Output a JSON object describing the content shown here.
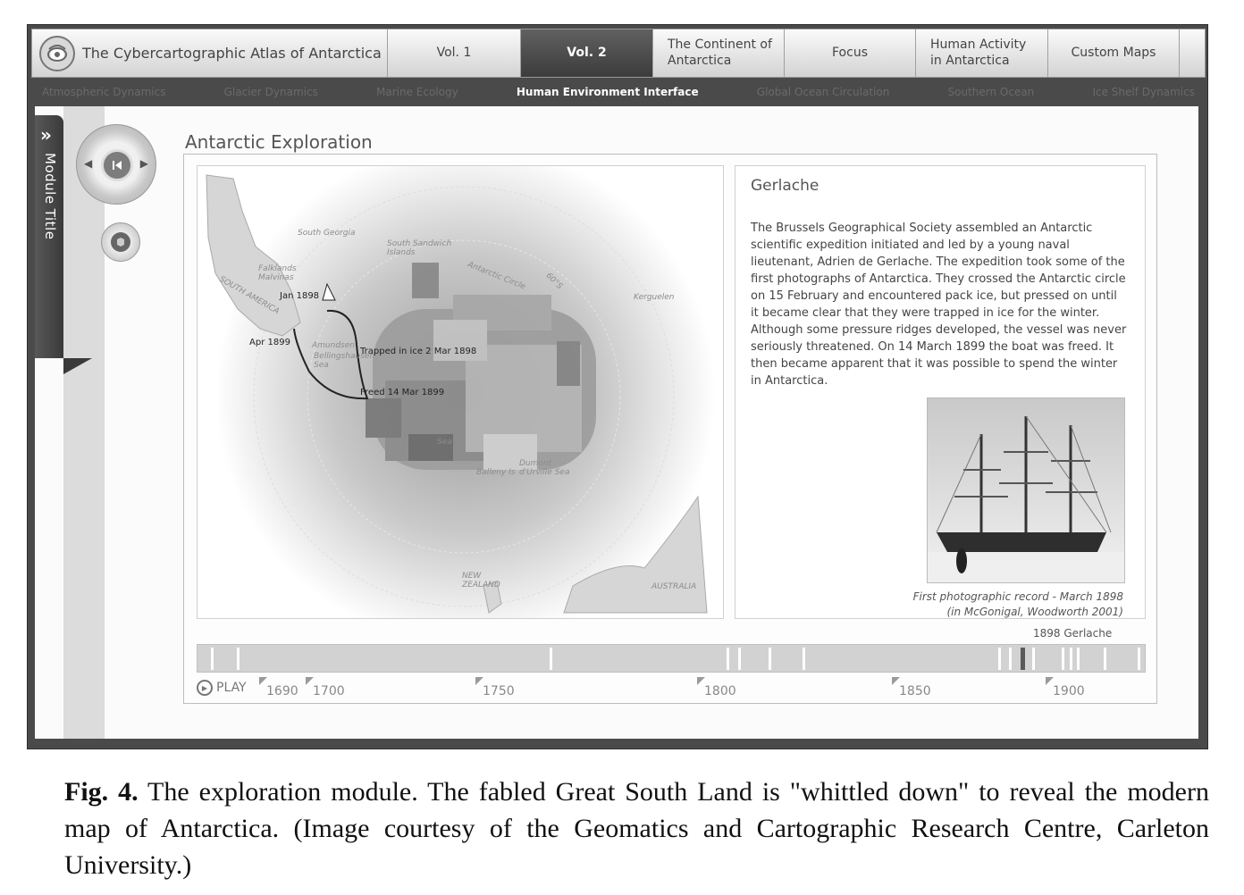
{
  "header": {
    "brand": "The Cybercartographic Atlas of Antarctica",
    "tabs": [
      {
        "label": "Vol. 1"
      },
      {
        "label": "Vol. 2",
        "active": true
      },
      {
        "line1": "The Continent of",
        "line2": "Antarctica"
      },
      {
        "label": "Focus"
      },
      {
        "line1": "Human Activity",
        "line2": "in Antarctica"
      },
      {
        "label": "Custom Maps"
      }
    ]
  },
  "subnav": [
    "Atmospheric Dynamics",
    "Glacier Dynamics",
    "Marine Ecology",
    "Human Environment Interface",
    "Global Ocean Circulation",
    "Southern Ocean",
    "Ice Shelf Dynamics"
  ],
  "subnav_active": "Human Environment Interface",
  "sidebar": {
    "chevron": "»",
    "title": "Module Title"
  },
  "module": {
    "title": "Antarctic Exploration"
  },
  "map": {
    "labels": [
      "South Georgia",
      "South Sandwich Islands",
      "Falklands Malvinas",
      "SOUTH AMERICA",
      "Jan 1898",
      "Apr 1899",
      "Trapped in ice 2 Mar 1898",
      "Freed 14 Mar 1899",
      "Antarctic Circle",
      "60°S",
      "Kerguelen",
      "Bellingshausen Sea",
      "Amundsen",
      "Dumont d'Urville Sea",
      "Balleny Is",
      "NEW ZEALAND",
      "AUSTRALIA",
      "Sea"
    ]
  },
  "info": {
    "heading": "Gerlache",
    "body": "The Brussels Geographical Society assembled an Antarctic scientific expedition initiated and led by a young naval lieutenant, Adrien de Gerlache. The expedition took some of the first photographs of Antarctica. They crossed the Antarctic circle on 15 February and encountered pack ice, but pressed on until it became clear that they were trapped in ice for the winter. Although some pressure ridges developed, the vessel was never seriously threatened. On 14 March 1899 the boat was freed. It then became apparent that it was possible to spend the winter in Antarctica.",
    "caption_line1": "First photographic record - March 1898",
    "caption_line2": "(in McGonigal, Woodworth 2001)"
  },
  "timeline": {
    "current_label": "1898 Gerlache",
    "play_label": "PLAY",
    "ticks": [
      "1690",
      "1700",
      "1750",
      "1800",
      "1850",
      "1900"
    ],
    "marker_years": [
      1683,
      1690,
      1773,
      1820,
      1823,
      1831,
      1840,
      1892,
      1895,
      1901,
      1909,
      1911,
      1913,
      1920,
      1929
    ],
    "current_year": 1898,
    "range": [
      1680,
      1930
    ]
  },
  "figure_caption": {
    "label": "Fig. 4.",
    "text": "The exploration module.    The fabled Great South Land is \"whittled down\" to reveal the modern map of Antarctica.  (Image courtesy of the Geomatics and Cartographic Research Centre, Carleton University.)"
  },
  "icons": [
    "atlas-logo-icon",
    "double-chevron-right-icon",
    "play-circle-icon",
    "nav-skip-back-icon",
    "map-layer-icon"
  ],
  "colors": {
    "frame": "#4a4a4a",
    "active_tab": "#4c4c4c",
    "panel": "#fbfbfb",
    "timeline": "#d2d2d2"
  }
}
